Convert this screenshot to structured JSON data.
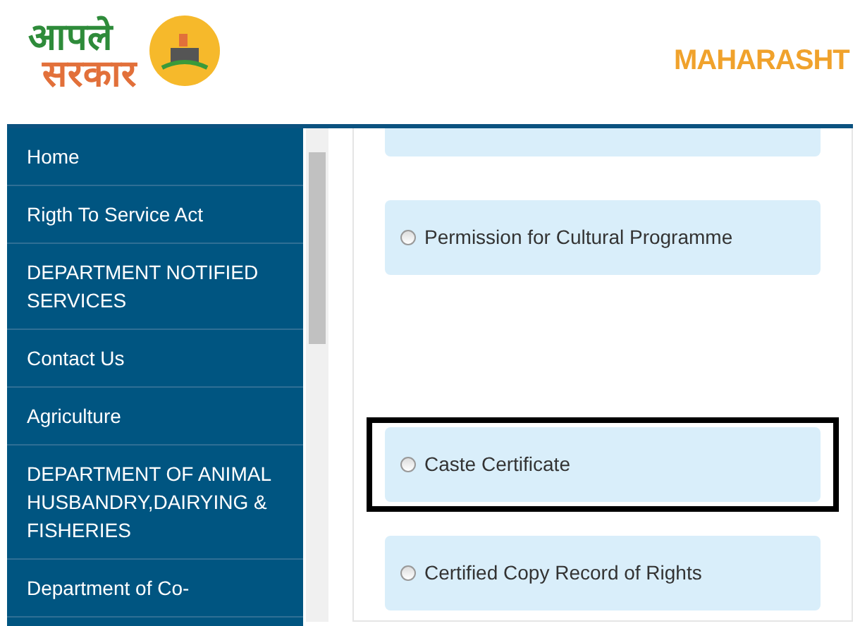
{
  "header": {
    "logo_text_top": "आपले",
    "logo_text_bottom": "सरकार",
    "site_title": "MAHARASHT"
  },
  "sidebar": {
    "items": [
      {
        "label": "Home"
      },
      {
        "label": "Rigth To Service Act"
      },
      {
        "label": "DEPARTMENT NOTIFIED SERVICES"
      },
      {
        "label": "Contact Us"
      },
      {
        "label": "Agriculture"
      },
      {
        "label": "DEPARTMENT OF ANIMAL HUSBANDRY,DAIRYING & FISHERIES"
      },
      {
        "label": "Department of Co-"
      }
    ]
  },
  "services": [
    {
      "label": "Permission for Cultural Programme",
      "selected": false,
      "highlighted": false
    },
    {
      "label": "Caste Certificate",
      "selected": false,
      "highlighted": true
    },
    {
      "label": "Certified Copy Record of Rights",
      "selected": false,
      "highlighted": false
    }
  ]
}
